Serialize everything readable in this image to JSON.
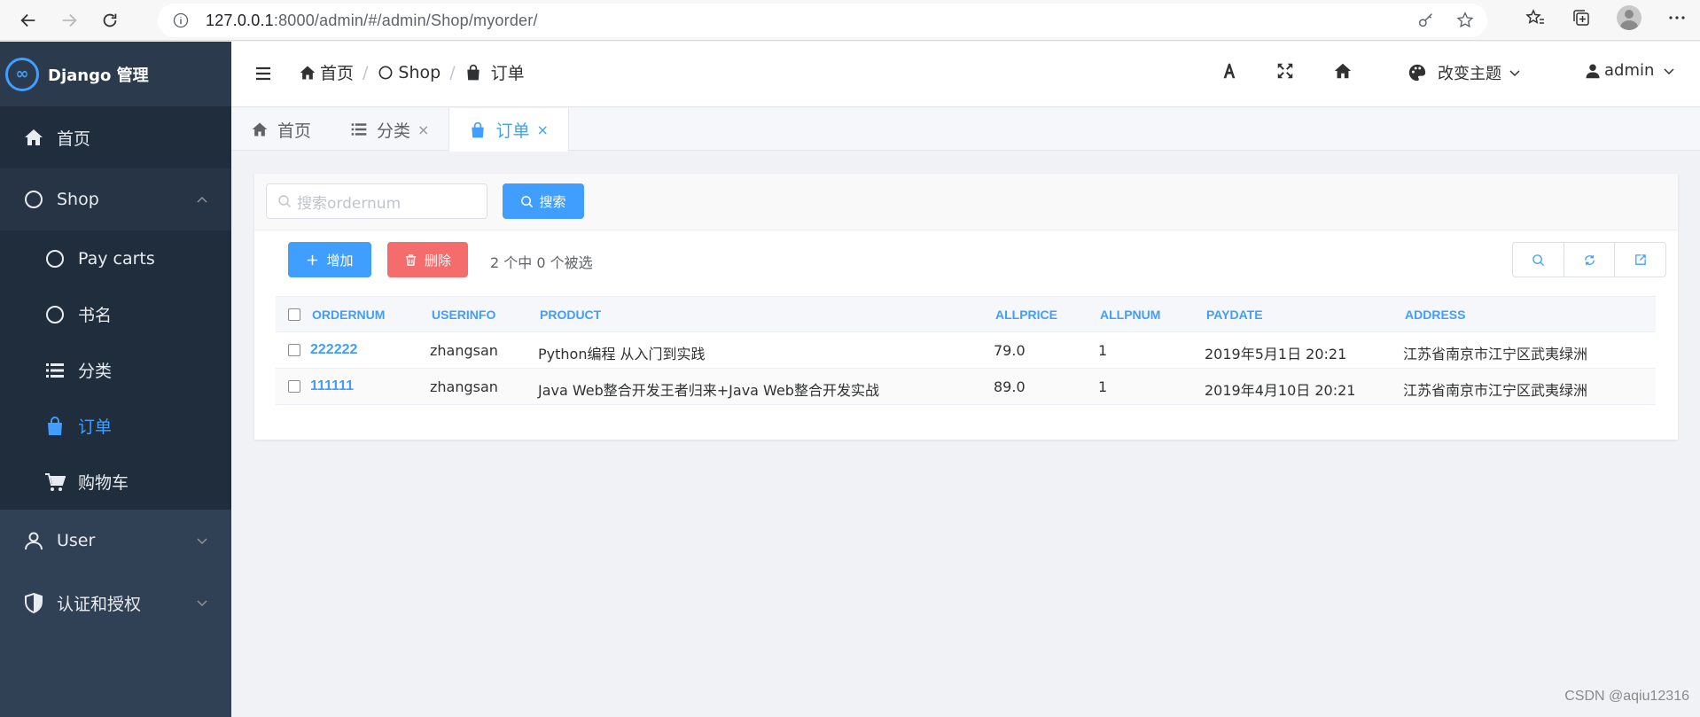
{
  "browser": {
    "url_host": "127.0.0.1",
    "url_rest": ":8000/admin/#/admin/Shop/myorder/"
  },
  "sidebar": {
    "logo_glyph": "∞",
    "logo_text": "Django 管理",
    "home_label": "首页",
    "shop_label": "Shop",
    "shop_items": [
      {
        "label": "Pay carts"
      },
      {
        "label": "书名"
      },
      {
        "label": "分类"
      },
      {
        "label": "订单"
      },
      {
        "label": "购物车"
      }
    ],
    "user_label": "User",
    "auth_label": "认证和授权"
  },
  "header": {
    "breadcrumb": [
      "首页",
      "Shop",
      "订单"
    ],
    "breadcrumb_sep": "/",
    "theme_label": "改变主题",
    "user_label": "admin"
  },
  "tabs": [
    {
      "label": "首页",
      "closable": false
    },
    {
      "label": "分类",
      "closable": true
    },
    {
      "label": "订单",
      "closable": true,
      "active": true
    }
  ],
  "tab_close_glyph": "×",
  "search": {
    "placeholder": "搜索ordernum",
    "button_label": "搜索"
  },
  "actions": {
    "add_label": "增加",
    "delete_label": "删除",
    "selection_text": "2 个中 0 个被选"
  },
  "table": {
    "columns": [
      "ORDERNUM",
      "USERINFO",
      "PRODUCT",
      "ALLPRICE",
      "ALLPNUM",
      "PAYDATE",
      "ADDRESS"
    ],
    "rows": [
      [
        "222222",
        "zhangsan",
        "Python编程 从入门到实践",
        "79.0",
        "1",
        "2019年5月1日 20:21",
        "江苏省南京市江宁区武夷绿洲"
      ],
      [
        "111111",
        "zhangsan",
        "Java Web整合开发王者归来+Java Web整合开发实战",
        "89.0",
        "1",
        "2019年4月10日 20:21",
        "江苏省南京市江宁区武夷绿洲"
      ]
    ]
  },
  "watermark": "CSDN @aqiu12316",
  "colors": {
    "accent": "#409eff",
    "danger": "#f56c6c",
    "sidebar": "#304156"
  }
}
